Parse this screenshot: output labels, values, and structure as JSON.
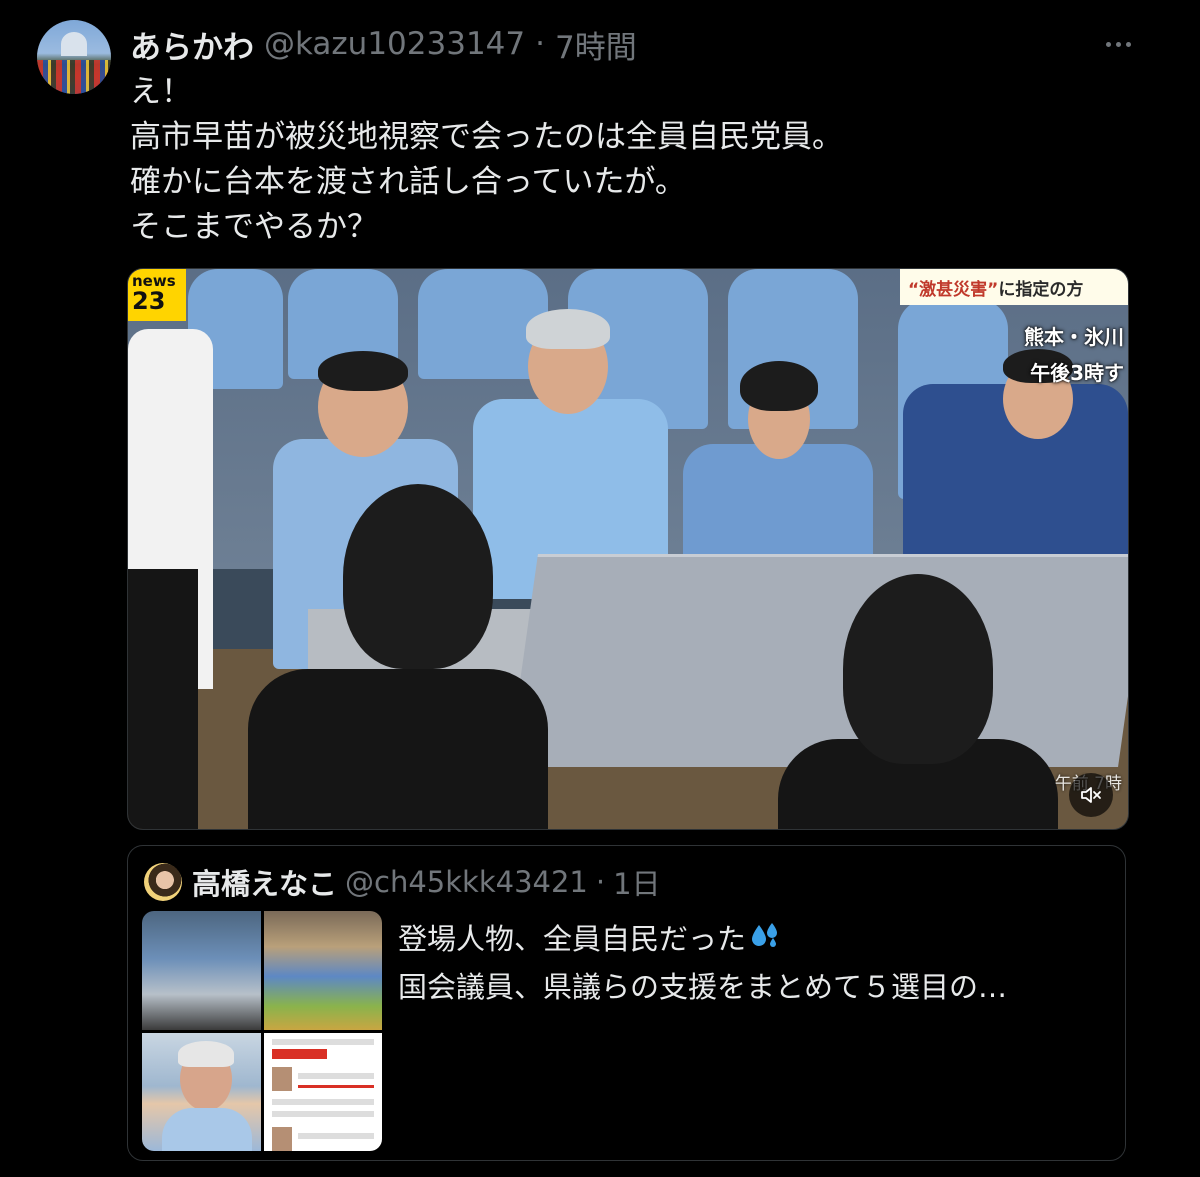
{
  "tweet": {
    "author_name": "あらかわ",
    "handle": "@kazu10233147",
    "separator": "·",
    "time": "7時間",
    "text": "え！\n高市早苗が被災地視察で会ったのは全員自民党員。\n確かに台本を渡され話し合っていたが。\nそこまでやるか？",
    "more_icon": "more-icon"
  },
  "video": {
    "news_logo_top": "news",
    "news_logo_num": "23",
    "caption_q1": "“激甚災害”",
    "caption_rest": "に指定の方",
    "location_1": "熊本・氷川",
    "location_2": "午後3時す",
    "time_overlay": "午前 7時",
    "mute_icon": "mute-icon"
  },
  "quote": {
    "author_name": "高橋えなこ",
    "handle": "@ch45kkk43421",
    "separator": "·",
    "time": "1日",
    "text_line1": "登場人物、全員自民だった",
    "text_rest": "\n国会議員、県議らの支援をまとめて５選目の…",
    "emoji_icon": "sweat-droplets-icon"
  },
  "colors": {
    "background": "#000000",
    "text_primary": "#e7e9ea",
    "text_secondary": "#71767b",
    "border": "#2f3336"
  }
}
